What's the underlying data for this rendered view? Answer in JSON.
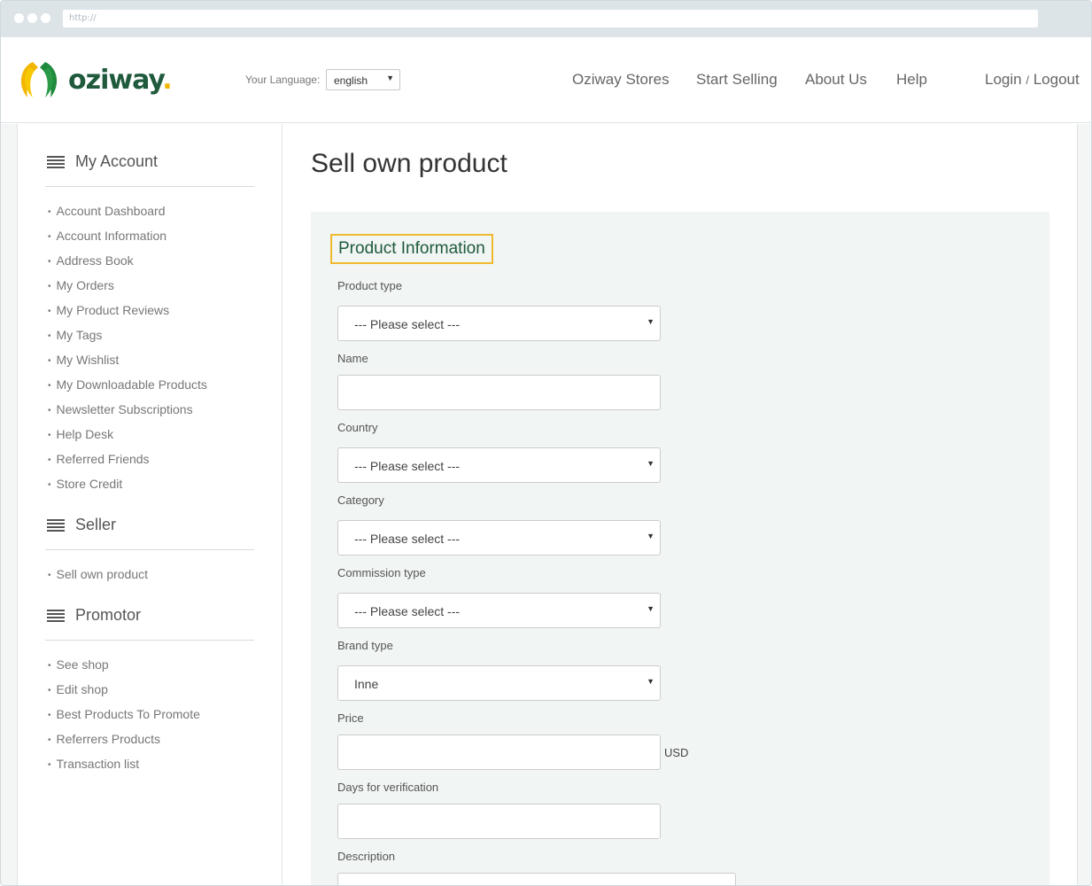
{
  "browser": {
    "url": "http://"
  },
  "header": {
    "logo_text": "oziway",
    "logo_dot": ".",
    "language_label": "Your Language:",
    "language_value": "english",
    "nav": [
      "Oziway Stores",
      "Start Selling",
      "About Us",
      "Help"
    ],
    "login_label": "Login",
    "login_sep": "/",
    "logout_label": "Logout"
  },
  "sidebar": {
    "account": {
      "title": "My Account",
      "items": [
        "Account Dashboard",
        "Account Information",
        "Address Book",
        "My Orders",
        "My Product Reviews",
        "My Tags",
        "My Wishlist",
        "My Downloadable Products",
        "Newsletter Subscriptions",
        "Help Desk",
        "Referred Friends",
        "Store Credit"
      ]
    },
    "seller": {
      "title": "Seller",
      "items": [
        "Sell own product"
      ]
    },
    "promotor": {
      "title": "Promotor",
      "items": [
        "See shop",
        "Edit shop",
        "Best Products To Promote",
        "Referrers Products",
        "Transaction list"
      ]
    }
  },
  "main": {
    "title": "Sell own product",
    "section_title": "Product Information",
    "fields": {
      "product_type": {
        "label": "Product type",
        "value": "--- Please select ---"
      },
      "name": {
        "label": "Name",
        "value": ""
      },
      "country": {
        "label": "Country",
        "value": "--- Please select ---"
      },
      "category": {
        "label": "Category",
        "value": "--- Please select ---"
      },
      "commission_type": {
        "label": "Commission type",
        "value": "--- Please select ---"
      },
      "brand_type": {
        "label": "Brand type",
        "value": "Inne"
      },
      "price": {
        "label": "Price",
        "value": "",
        "unit": "USD"
      },
      "days_verification": {
        "label": "Days for verification",
        "value": ""
      },
      "description": {
        "label": "Description",
        "value": ""
      }
    }
  },
  "colors": {
    "brand_green": "#1f5a3c",
    "brand_yellow": "#f2b600",
    "highlight_border": "#efb930",
    "panel_bg": "#f1f5f3"
  }
}
